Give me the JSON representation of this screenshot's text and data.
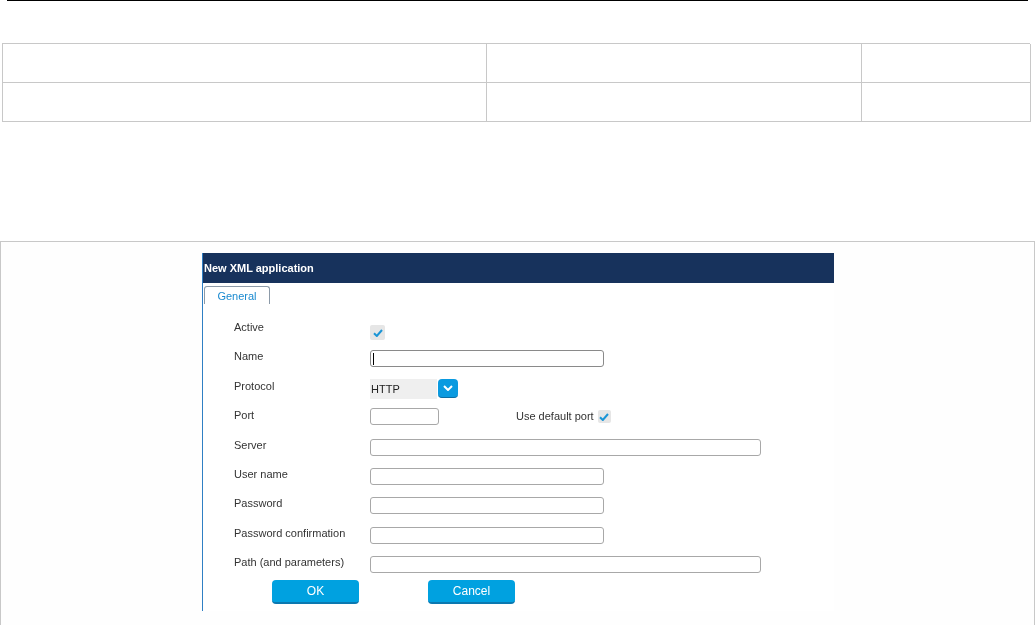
{
  "dialog": {
    "title": "New XML application",
    "tabs": [
      {
        "label": "General",
        "selected": true
      }
    ],
    "fields": [
      {
        "kind": "checkbox",
        "label": "Active",
        "checked": true
      },
      {
        "kind": "text",
        "label": "Name",
        "focused": true
      },
      {
        "kind": "select",
        "label": "Protocol",
        "value": "HTTP"
      },
      {
        "kind": "port",
        "label": "Port",
        "focused": false,
        "option_label": "Use default port",
        "option_checked": true
      },
      {
        "kind": "wide",
        "label": "Server",
        "focused": false
      },
      {
        "kind": "text",
        "label": "User name",
        "focused": false
      },
      {
        "kind": "text",
        "label": "Password",
        "focused": false
      },
      {
        "kind": "text",
        "label": "Password confirmation",
        "focused": false
      },
      {
        "kind": "wide",
        "label": "Path (and parameters)",
        "focused": false
      }
    ],
    "buttons": [
      {
        "label": "OK"
      },
      {
        "label": "Cancel"
      }
    ]
  }
}
